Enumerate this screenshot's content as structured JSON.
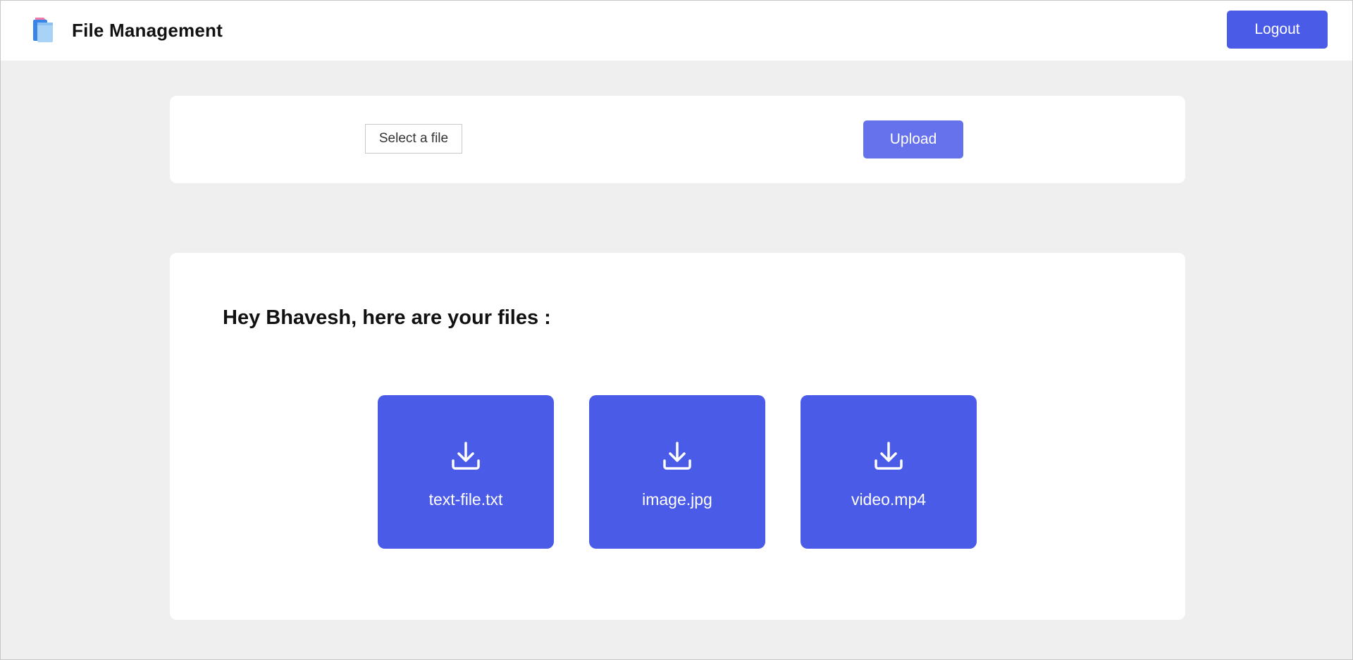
{
  "header": {
    "title": "File Management",
    "logo_icon": "folder-pages-icon",
    "logout_label": "Logout"
  },
  "upload": {
    "select_label": "Select a file",
    "upload_label": "Upload"
  },
  "files": {
    "heading": "Hey Bhavesh, here are your files :",
    "items": [
      {
        "name": "text-file.txt",
        "icon": "download-icon"
      },
      {
        "name": "image.jpg",
        "icon": "download-icon"
      },
      {
        "name": "video.mp4",
        "icon": "download-icon"
      }
    ]
  },
  "colors": {
    "accent": "#4a5be8",
    "upload_button": "#6672ec",
    "page_background": "#efefef",
    "card_background": "#ffffff"
  }
}
